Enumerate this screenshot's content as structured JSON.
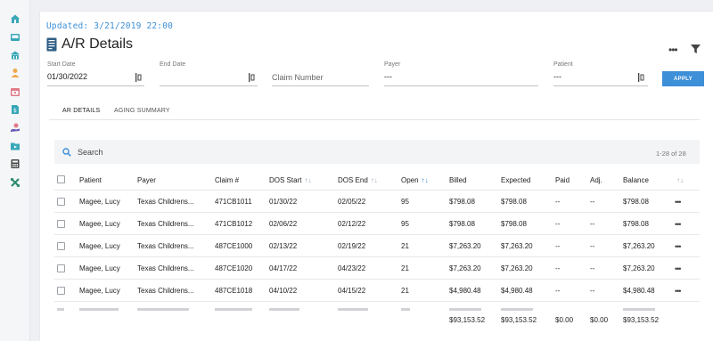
{
  "sidebar": {
    "icons": [
      "home-icon",
      "inbox-icon",
      "bank-icon",
      "user-icon",
      "calendar-icon",
      "document-icon",
      "payment-icon",
      "folder-icon",
      "calculator-icon",
      "tools-icon"
    ]
  },
  "header": {
    "updated": "Updated: 3/21/2019 22:00",
    "title": "A/R Details",
    "more": "•••"
  },
  "filters": {
    "start_date_label": "Start Date",
    "start_date_value": "01/30/2022",
    "end_date_label": "End Date",
    "end_date_value": "",
    "claim_number_placeholder": "Claim Number",
    "payer_label": "Payer",
    "payer_value": "---",
    "patient_label": "Patient",
    "patient_value": "---",
    "apply_label": "APPLY"
  },
  "tabs": [
    {
      "label": "AR DETAILS",
      "active": true
    },
    {
      "label": "AGING SUMMARY",
      "active": false
    }
  ],
  "table": {
    "search_placeholder": "Search",
    "count": "1-28 of 28",
    "columns": [
      "Patient",
      "Payer",
      "Claim #",
      "DOS Start",
      "DOS End",
      "Open",
      "Billed",
      "Expected",
      "Paid",
      "Adj.",
      "Balance"
    ],
    "sort_arrows": "↑↓",
    "open_sort": "↑↓",
    "rows": [
      {
        "patient": "Magee, Lucy",
        "payer": "Texas Childrens...",
        "claim": "471CB1011",
        "dos_start": "01/30/22",
        "dos_end": "02/05/22",
        "open": "95",
        "billed": "$798.08",
        "expected": "$798.08",
        "paid": "--",
        "adj": "--",
        "balance": "$798.08"
      },
      {
        "patient": "Magee, Lucy",
        "payer": "Texas Childrens...",
        "claim": "471CB1012",
        "dos_start": "02/06/22",
        "dos_end": "02/12/22",
        "open": "95",
        "billed": "$798.08",
        "expected": "$798.08",
        "paid": "--",
        "adj": "--",
        "balance": "$798.08"
      },
      {
        "patient": "Magee, Lucy",
        "payer": "Texas Childrens...",
        "claim": "487CE1000",
        "dos_start": "02/13/22",
        "dos_end": "02/19/22",
        "open": "21",
        "billed": "$7,263.20",
        "expected": "$7,263.20",
        "paid": "--",
        "adj": "--",
        "balance": "$7,263.20"
      },
      {
        "patient": "Magee, Lucy",
        "payer": "Texas Childrens...",
        "claim": "487CE1020",
        "dos_start": "04/17/22",
        "dos_end": "04/23/22",
        "open": "21",
        "billed": "$7,263.20",
        "expected": "$7,263.20",
        "paid": "--",
        "adj": "--",
        "balance": "$7,263.20"
      },
      {
        "patient": "Magee, Lucy",
        "payer": "Texas Childrens...",
        "claim": "487CE1018",
        "dos_start": "04/10/22",
        "dos_end": "04/15/22",
        "open": "21",
        "billed": "$4,980.48",
        "expected": "$4,980.48",
        "paid": "--",
        "adj": "--",
        "balance": "$4,980.48"
      }
    ],
    "row_more": "•••",
    "totals": {
      "billed": "$93,153.52",
      "expected": "$93,153.52",
      "paid": "$0.00",
      "adj": "$0.00",
      "balance": "$93,153.52"
    }
  },
  "colors": {
    "accent": "#3d8fd8",
    "sidebar_icon": "#3aa7b8",
    "sidebar_icon_alt": "#e07a8a"
  }
}
